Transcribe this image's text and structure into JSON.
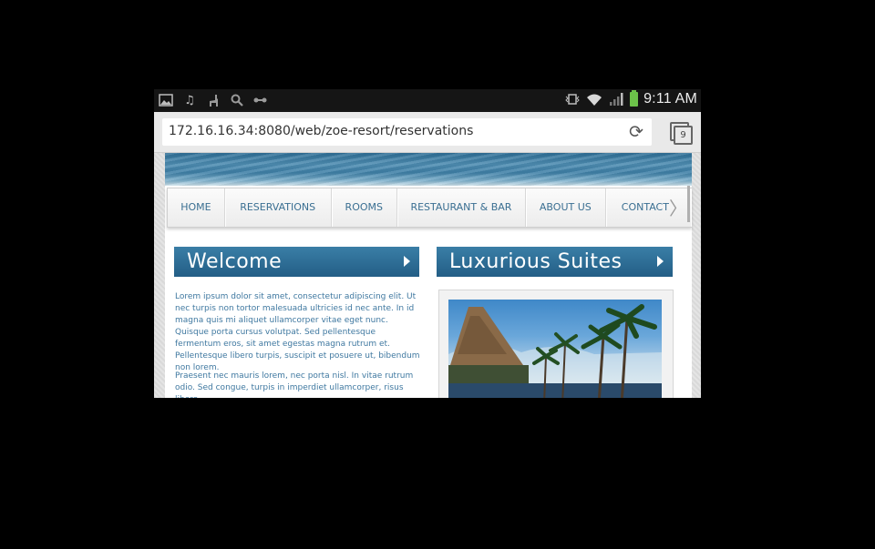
{
  "status_bar": {
    "time": "9:11 AM",
    "left_icons": [
      "image-icon",
      "music-note-icon",
      "llama-icon",
      "search-icon",
      "usb-icon"
    ],
    "right_icons": [
      "vibrate-icon",
      "wifi-icon",
      "signal-icon",
      "battery-icon"
    ]
  },
  "browser": {
    "url": "172.16.16.34:8080/web/zoe-resort/reservations",
    "tab_count": "9"
  },
  "nav": {
    "items": [
      "HOME",
      "RESERVATIONS",
      "ROOMS",
      "RESTAURANT & BAR",
      "ABOUT US",
      "CONTACT"
    ]
  },
  "welcome": {
    "title": "Welcome",
    "paragraph1": "Lorem ipsum dolor sit amet, consectetur adipiscing elit. Ut nec turpis non tortor malesuada ultricies id nec ante. In id magna quis mi aliquet ullamcorper vitae eget nunc. Quisque porta cursus volutpat. Sed pellentesque fermentum eros, sit amet egestas magna rutrum et. Pellentesque libero turpis, suscipit et posuere ut, bibendum non lorem.",
    "paragraph2": "Praesent nec mauris lorem, nec porta nisl. In vitae rutrum odio. Sed congue, turpis in imperdiet ullamcorper, risus libero"
  },
  "suites": {
    "title": "Luxurious Suites"
  },
  "colors": {
    "accent_blue": "#2d6a93",
    "text_blue": "#3f78a0"
  }
}
